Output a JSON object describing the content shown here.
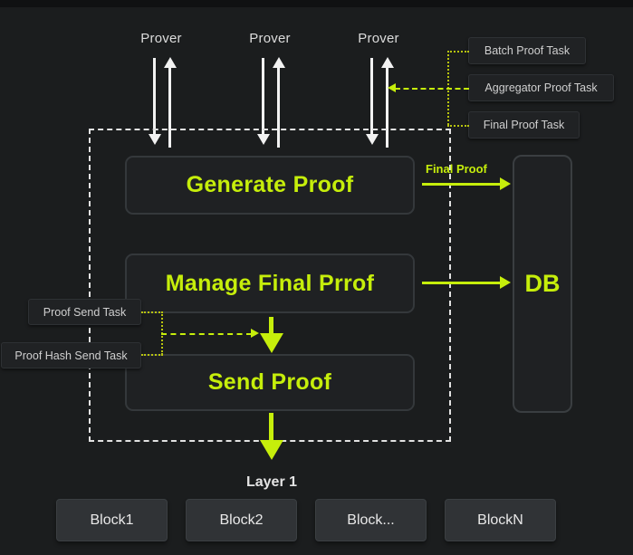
{
  "diagram": {
    "background_color": "#1b1d1e",
    "accent_color": "#c6ee0b",
    "provers": [
      {
        "label": "Prover"
      },
      {
        "label": "Prover"
      },
      {
        "label": "Prover"
      }
    ],
    "process_boxes": [
      {
        "label": "Generate Proof"
      },
      {
        "label": "Manage Final Prrof"
      },
      {
        "label": "Send Proof"
      }
    ],
    "database": {
      "label": "DB"
    },
    "right_tasks": [
      {
        "label": "Batch Proof Task"
      },
      {
        "label": "Aggregator Proof Task"
      },
      {
        "label": "Final Proof Task"
      }
    ],
    "left_tasks": [
      {
        "label": "Proof Send Task"
      },
      {
        "label": "Proof Hash Send Task"
      }
    ],
    "edge_labels": {
      "final_proof": "Final Proof"
    },
    "layer_label": "Layer 1",
    "blocks": [
      {
        "label": "Block1"
      },
      {
        "label": "Block2"
      },
      {
        "label": "Block..."
      },
      {
        "label": "BlockN"
      }
    ]
  }
}
